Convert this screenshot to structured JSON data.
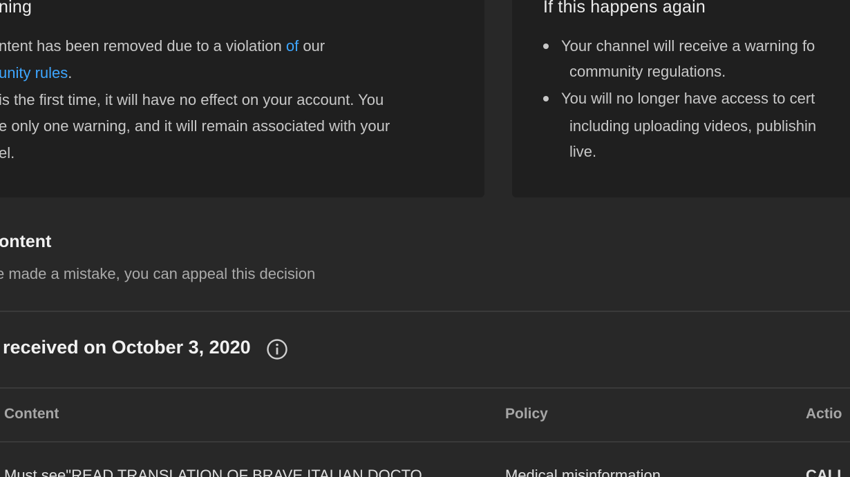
{
  "warning_card": {
    "title": "ning",
    "line1_a": "ntent has been removed due to a violation ",
    "line1_link": "of",
    "line1_b": " our",
    "line2_link": "unity rules",
    "line2_b": ".",
    "line3": "is the first time, it will have no effect on your account. You",
    "line4": "e only one warning, and it will remain associated with your",
    "line5": "el."
  },
  "again_card": {
    "title": "If this happens again",
    "bullets": [
      {
        "line1": "Your channel will receive a warning fo",
        "line2": "community regulations."
      },
      {
        "line1": "You will no longer have access to cert",
        "line2": "including uploading videos, publishin",
        "line3": "live."
      }
    ]
  },
  "appeal": {
    "title": "ontent",
    "subtitle": "e made a mistake, you can appeal this decision"
  },
  "strike": {
    "heading": "received on October 3, 2020",
    "info_icon": "info-circle-icon"
  },
  "table": {
    "columns": [
      "Content",
      "Policy",
      "Actio"
    ],
    "row": {
      "content": "Must see\"READ TRANSLATION OF BRAVE ITALIAN DOCTO",
      "policy": "Medical misinformation",
      "action": "CALL"
    }
  },
  "colors": {
    "link": "#3ea6ff",
    "background": "#282828",
    "card": "#1f1f1f"
  }
}
